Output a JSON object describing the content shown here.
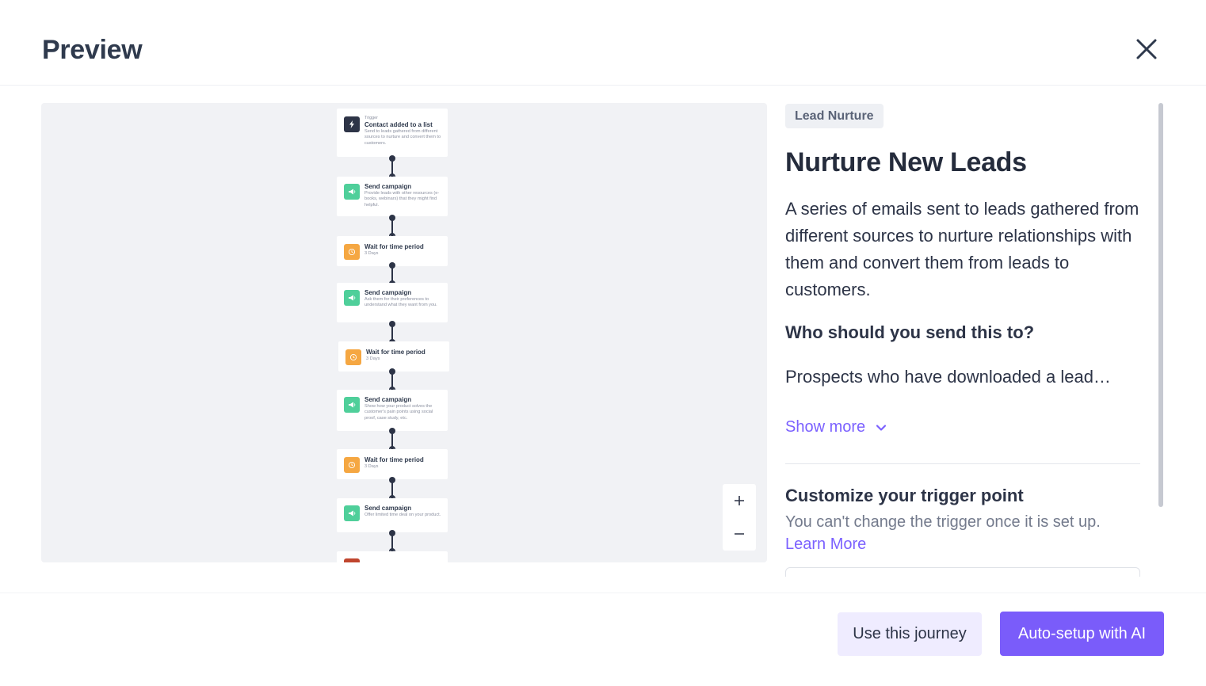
{
  "header": {
    "title": "Preview",
    "close_icon": "close-icon"
  },
  "flow": {
    "nodes": [
      {
        "kind": "trigger",
        "icon": "lightning-icon",
        "color": "#2d3447",
        "label": "Trigger",
        "title": "Contact added to a list",
        "desc": "Send to leads gathered from different sources to nurture and convert them to customers."
      },
      {
        "kind": "campaign",
        "icon": "megaphone-icon",
        "color": "#4fcf9a",
        "title": "Send campaign",
        "desc": "Provide leads with other resources (e-books, webinars) that they might find helpful."
      },
      {
        "kind": "wait",
        "icon": "clock-icon",
        "color": "#f5a742",
        "title": "Wait for time period",
        "desc": "3 Days"
      },
      {
        "kind": "campaign",
        "icon": "megaphone-icon",
        "color": "#4fcf9a",
        "title": "Send campaign",
        "desc": "Ask them for their preferences to understand what they want from you."
      },
      {
        "kind": "wait",
        "icon": "clock-icon",
        "color": "#f5a742",
        "title": "Wait for time period",
        "desc": "3 Days"
      },
      {
        "kind": "campaign",
        "icon": "megaphone-icon",
        "color": "#4fcf9a",
        "title": "Send campaign",
        "desc": "Show how your product solves the customer's pain points using social proof, case study, etc."
      },
      {
        "kind": "wait",
        "icon": "clock-icon",
        "color": "#f5a742",
        "title": "Wait for time period",
        "desc": "3 Days"
      },
      {
        "kind": "campaign",
        "icon": "megaphone-icon",
        "color": "#4fcf9a",
        "title": "Send campaign",
        "desc": "Offer limited time deal on your product."
      },
      {
        "kind": "exit",
        "icon": "exit-icon",
        "color": "#c0462e",
        "title": "",
        "desc": ""
      }
    ],
    "zoom_in_icon": "plus-icon",
    "zoom_out_icon": "minus-icon"
  },
  "details": {
    "category": "Lead Nurture",
    "title": "Nurture New Leads",
    "description": "A series of emails sent to leads gathered from different sources to nurture relationships with them and convert them from leads to customers.",
    "who_heading": "Who should you send this to?",
    "who_text": "Prospects who have downloaded a lead…",
    "show_more": "Show more",
    "customize_heading": "Customize your trigger point",
    "customize_text": "You can't change the trigger once it is set up.",
    "learn_more": "Learn More"
  },
  "footer": {
    "secondary_button": "Use this journey",
    "primary_button": "Auto-setup with AI"
  },
  "colors": {
    "accent": "#7a5cfa",
    "accent_light": "#efecff",
    "canvas_bg": "#f1f2f5"
  }
}
